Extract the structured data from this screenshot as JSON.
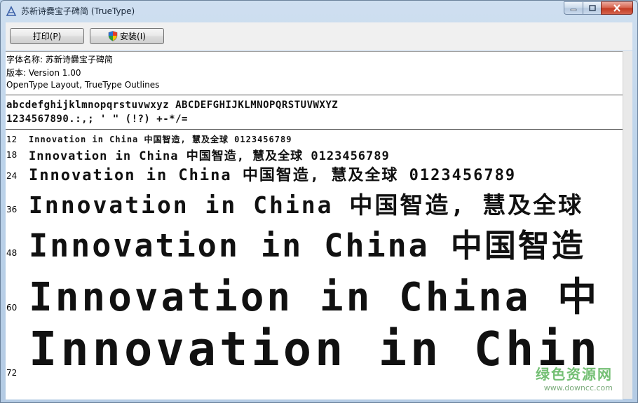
{
  "window": {
    "title": "苏新诗爨宝子碑简 (TrueType)"
  },
  "toolbar": {
    "print_label": "打印(P)",
    "install_label": "安装(I)"
  },
  "info": {
    "font_name": "字体名称: 苏新诗爨宝子碑简",
    "version": "版本: Version 1.00",
    "type": "OpenType Layout, TrueType Outlines"
  },
  "charset": {
    "line1": "abcdefghijklmnopqrstuvwxyz ABCDEFGHIJKLMNOPQRSTUVWXYZ",
    "line2": "1234567890.:,; ' \" (!?) +-*/="
  },
  "samples": [
    {
      "size": "12",
      "text": "Innovation in China 中国智造, 慧及全球 0123456789"
    },
    {
      "size": "18",
      "text": "Innovation in China 中国智造, 慧及全球 0123456789"
    },
    {
      "size": "24",
      "text": "Innovation in China 中国智造, 慧及全球 0123456789"
    },
    {
      "size": "36",
      "text": "Innovation in China 中国智造, 慧及全球"
    },
    {
      "size": "48",
      "text": "Innovation in China 中国智造"
    },
    {
      "size": "60",
      "text": "Innovation in China 中"
    },
    {
      "size": "72",
      "text": "Innovation in Chin"
    }
  ],
  "watermark": {
    "main": "绿色资源网",
    "sub": "www.downcc.com"
  }
}
